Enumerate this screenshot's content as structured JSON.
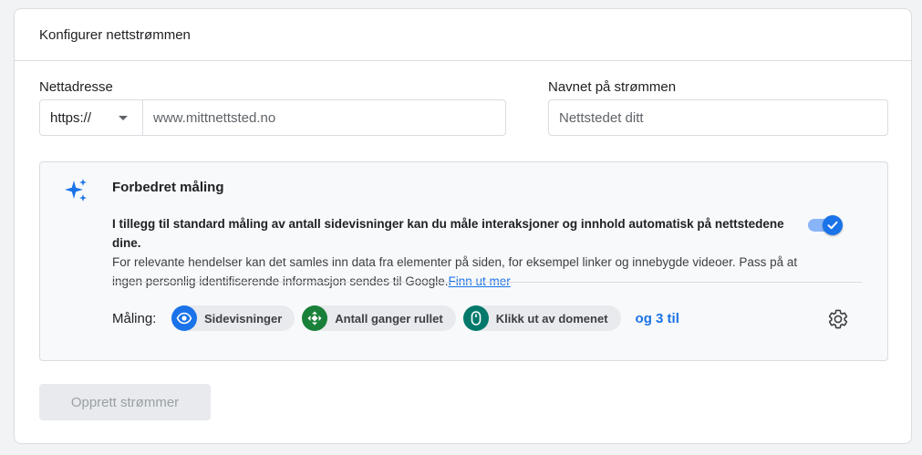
{
  "header": {
    "title": "Konfigurer nettstrømmen"
  },
  "url_field": {
    "label": "Nettadresse",
    "protocol": "https://",
    "placeholder": "www.mittnettsted.no"
  },
  "name_field": {
    "label": "Navnet på strømmen",
    "placeholder": "Nettstedet ditt"
  },
  "enhanced": {
    "title": "Forbedret måling",
    "desc_bold": "I tillegg til standard måling av antall sidevisninger kan du måle interaksjoner og innhold automatisk på nettstedene dine.",
    "desc_normal": "For relevante hendelser kan det samles inn data fra elementer på siden, for eksempel linker og innebygde videoer. Pass på at ingen personlig identifiserende informasjon sendes til Google.",
    "learn_more": "Finn ut mer",
    "toggle_on": true,
    "measurement_label": "Måling:",
    "chips": [
      {
        "label": "Sidevisninger",
        "icon": "eye-icon",
        "color": "#1a73e8"
      },
      {
        "label": "Antall ganger rullet",
        "icon": "scroll-icon",
        "color": "#188038"
      },
      {
        "label": "Klikk ut av domenet",
        "icon": "mouse-icon",
        "color": "#00796b"
      }
    ],
    "more": "og 3 til"
  },
  "create_button": {
    "label": "Opprett strømmer",
    "enabled": false
  },
  "colors": {
    "accent": "#1a73e8",
    "toggle_track": "#8ab4f8"
  }
}
